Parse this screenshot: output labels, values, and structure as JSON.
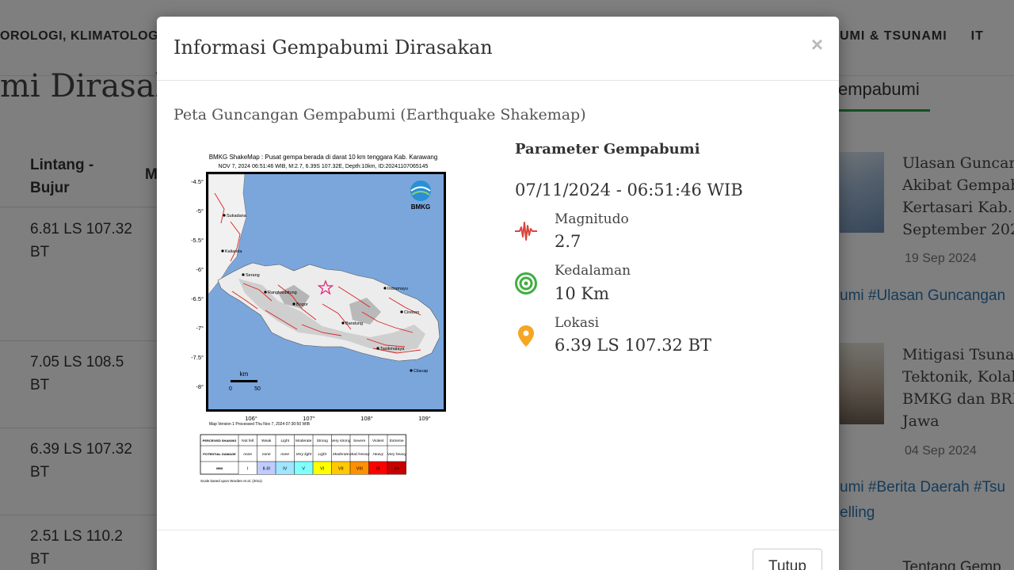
{
  "nav": {
    "left_text": "OROLOGI, KLIMATOLOGI",
    "right_text": "UMI & TSUNAMI",
    "right_it": "IT"
  },
  "page": {
    "title": "mi Dirasakan"
  },
  "table": {
    "header_col1": "Lintang - Bujur",
    "header_col2": "M",
    "rows": [
      "6.81 LS 107.32 BT",
      "7.05 LS 108.5 BT",
      "6.39 LS 107.32 BT",
      "2.51 LS 110.2 BT"
    ]
  },
  "sidebar": {
    "tab_label": "empabumi",
    "news": [
      {
        "title": "Ulasan Guncan\nAkibat Gempab\nKertasari Kab. \nSeptember 202",
        "date": "19 Sep 2024",
        "tags": "umi #Ulasan Guncangan"
      },
      {
        "title": "Mitigasi Tsuna\nTektonik, Kolab\nBMKG dan BRI\nJawa",
        "date": "04 Sep 2024",
        "tags": "umi #Berita Daerah #Tsu\nelling"
      }
    ],
    "news3_title": "Tentang Gemp"
  },
  "modal": {
    "title": "Informasi Gempabumi Dirasakan",
    "close_symbol": "×",
    "section_title": "Peta Guncangan Gempabumi (Earthquake Shakemap)",
    "close_button": "Tutup"
  },
  "shakemap": {
    "header_line1": "BMKG ShakeMap : Pusat gempa berada di darat 10 km tenggara Kab. Karawang",
    "header_line2": "NOV 7, 2024 06:51:46 WIB, M:2.7, 6.39S 107.32E, Depth:10km, ID:20241107065145",
    "logo_text": "BMKG",
    "lat_ticks": [
      "-4.5°",
      "-5°",
      "-5.5°",
      "-6°",
      "-6.5°",
      "-7°",
      "-7.5°",
      "-8°"
    ],
    "lon_ticks": [
      "106°",
      "107°",
      "108°",
      "109°"
    ],
    "cities": [
      "Sukadana",
      "Kalianda",
      "Serang",
      "Rangkasbitung",
      "Bogor",
      "Indramayu",
      "Cirebon",
      "Bandung",
      "Tasikmalaya",
      "Cilacap"
    ],
    "scale_label": "km",
    "scale_values": [
      "0",
      "50"
    ],
    "version_note": "Map Version 1 Processed Thu Nov 7, 2024 07:30:50 WIB",
    "legend_rows": [
      "PERCEIVED SHAKING",
      "POTENTIAL DAMAGE",
      "MMI"
    ],
    "shaking": [
      "Not felt",
      "Weak",
      "Light",
      "Moderate",
      "Strong",
      "Very strong",
      "Severe",
      "Violent",
      "Extreme"
    ],
    "damage": [
      "none",
      "none",
      "none",
      "Very light",
      "Light",
      "Moderate",
      "Mod./Heavy",
      "Heavy",
      "Very heavy"
    ],
    "mmi": [
      "I",
      "II-III",
      "IV",
      "V",
      "VI",
      "VII",
      "VIII",
      "IX",
      "X+"
    ],
    "mmi_colors": [
      "#ffffff",
      "#bfccff",
      "#a0e6ff",
      "#80ffff",
      "#ffff00",
      "#ffc800",
      "#ff9100",
      "#ff0000",
      "#c80000"
    ],
    "footnote": "Scale based upon Worden et al. (2011)"
  },
  "params": {
    "title": "Parameter Gempabumi",
    "datetime": "07/11/2024 - 06:51:46 WIB",
    "magnitude_label": "Magnitudo",
    "magnitude_value": "2.7",
    "depth_label": "Kedalaman",
    "depth_value": "10 Km",
    "location_label": "Lokasi",
    "location_value": "6.39 LS 107.32 BT",
    "colors": {
      "magnitude_icon": "#d9453d",
      "depth_icon": "#3fae3f",
      "location_icon": "#f5a623"
    }
  }
}
